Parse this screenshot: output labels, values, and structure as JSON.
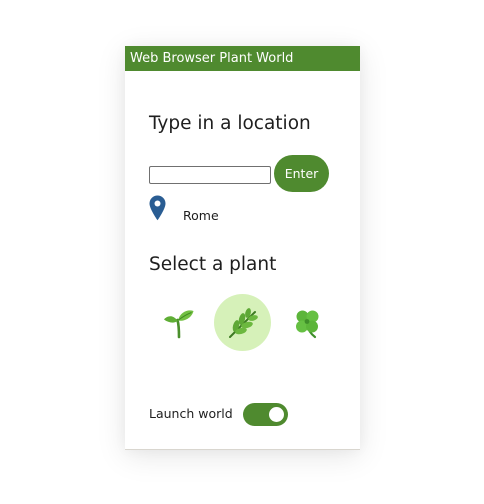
{
  "window": {
    "title": "Web Browser Plant World"
  },
  "location": {
    "heading": "Type in a location",
    "input_value": "",
    "input_placeholder": "",
    "enter_label": "Enter",
    "current_location": "Rome",
    "pin_icon": "map-pin-icon"
  },
  "plant_select": {
    "heading": "Select a plant",
    "options": [
      {
        "icon": "seedling-icon",
        "selected": false
      },
      {
        "icon": "herb-icon",
        "selected": true
      },
      {
        "icon": "four-leaf-clover-icon",
        "selected": false
      }
    ]
  },
  "launch": {
    "label": "Launch world",
    "enabled": true
  },
  "colors": {
    "brand_green": "#4f8a2f",
    "selected_bg": "#d6f1b9",
    "pin_blue": "#2a5d93"
  }
}
